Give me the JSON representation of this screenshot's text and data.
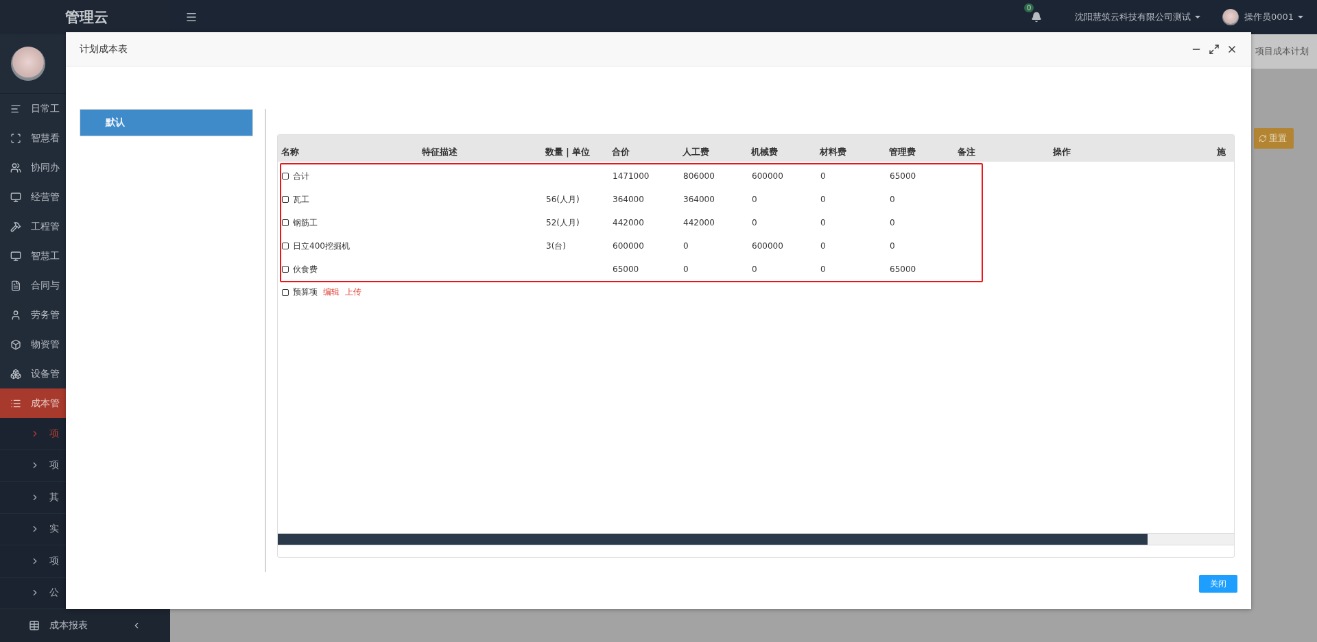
{
  "topbar": {
    "logo": "管理云",
    "notifications": "0",
    "company": "沈阳慧筑云科技有限公司测试",
    "user": "操作员0001"
  },
  "sidebar": {
    "items": [
      {
        "label": "日常工",
        "selected": false
      },
      {
        "label": "智慧看",
        "selected": false
      },
      {
        "label": "协同办",
        "selected": false
      },
      {
        "label": "经营管",
        "selected": false
      },
      {
        "label": "工程管",
        "selected": false
      },
      {
        "label": "智慧工",
        "selected": false
      },
      {
        "label": "合同与",
        "selected": false
      },
      {
        "label": "劳务管",
        "selected": false
      },
      {
        "label": "物资管",
        "selected": false
      },
      {
        "label": "设备管",
        "selected": false
      },
      {
        "label": "成本管",
        "selected": true
      }
    ],
    "subitems": [
      {
        "label": "项",
        "selected": true
      },
      {
        "label": "项",
        "selected": false
      },
      {
        "label": "其",
        "selected": false
      },
      {
        "label": "实",
        "selected": false
      },
      {
        "label": "项",
        "selected": false
      },
      {
        "label": "公",
        "selected": false
      }
    ],
    "footer_item": {
      "label": "成本报表"
    }
  },
  "background": {
    "breadcrumb": "项目成本计划",
    "reset_button": "重置"
  },
  "dialog": {
    "title": "计划成本表",
    "groups": [
      {
        "label": "默认",
        "selected": true
      }
    ],
    "table": {
      "columns": [
        "名称",
        "特征描述",
        "数量｜单位",
        "合价",
        "人工费",
        "机械费",
        "材料费",
        "管理费",
        "备注",
        "操作",
        "施"
      ],
      "rows": [
        {
          "checked": false,
          "name": "合计",
          "total": "1471000",
          "labor": "806000",
          "machinery": "600000",
          "material": "0",
          "management": "65000"
        },
        {
          "checked": false,
          "name": "瓦工",
          "quantity": "56(人月)",
          "total": "364000",
          "labor": "364000",
          "machinery": "0",
          "material": "0",
          "management": "0"
        },
        {
          "checked": false,
          "name": "钢筋工",
          "quantity": "52(人月)",
          "total": "442000",
          "labor": "442000",
          "machinery": "0",
          "material": "0",
          "management": "0"
        },
        {
          "checked": false,
          "name": "日立400挖掘机",
          "quantity": "3(台)",
          "total": "600000",
          "labor": "0",
          "machinery": "600000",
          "material": "0",
          "management": "0"
        },
        {
          "checked": false,
          "name": "伙食费",
          "total": "65000",
          "labor": "0",
          "machinery": "0",
          "material": "0",
          "management": "65000"
        }
      ],
      "extra_row": {
        "checked": false,
        "label": "预算项",
        "links": [
          "编辑",
          "上传"
        ]
      }
    },
    "close_button": "关闭"
  }
}
